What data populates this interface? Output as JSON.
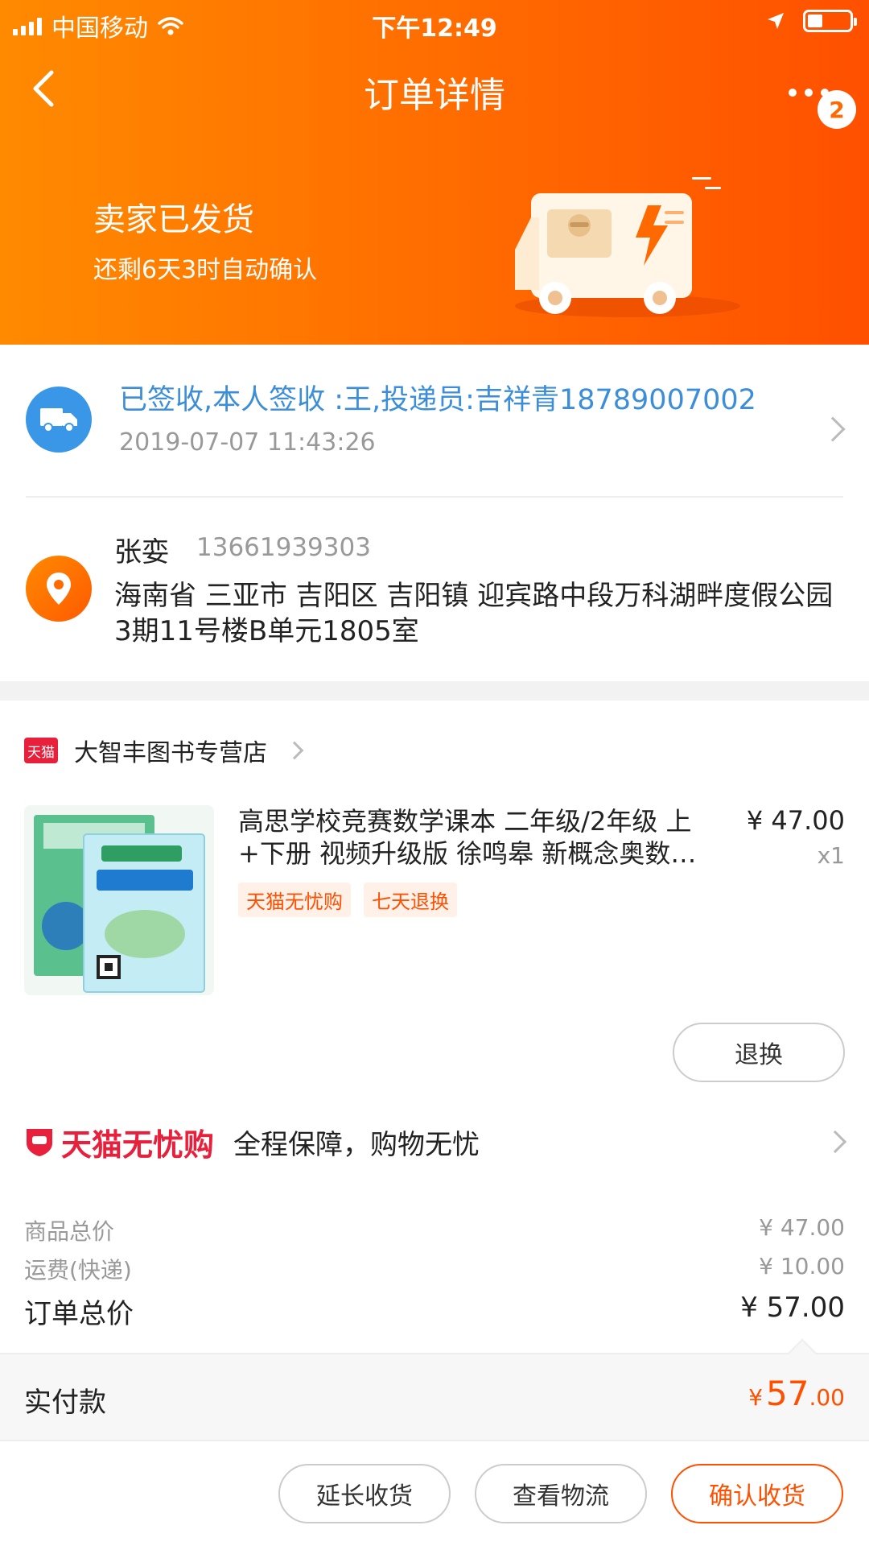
{
  "statusbar": {
    "carrier": "中国移动",
    "time": "下午12:49",
    "battery_level": 0.35
  },
  "nav": {
    "title": "订单详情",
    "badge_count": "2"
  },
  "shipping": {
    "status": "卖家已发货",
    "auto_confirm": "还剩6天3时自动确认"
  },
  "logistics": {
    "latest": "已签收,本人签收 :王,投递员:吉祥青18789007002",
    "time": "2019-07-07 11:43:26"
  },
  "receiver": {
    "name": "张娈",
    "phone": "13661939303",
    "address": "海南省 三亚市 吉阳区 吉阳镇 迎宾路中段万科湖畔度假公园3期11号楼B单元1805室"
  },
  "shop": {
    "badge": "天猫",
    "name": "大智丰图书专营店"
  },
  "product": {
    "title": "高思学校竞赛数学课本 二年级/2年级 上+下册 视频升级版 徐鸣皋 新概念奥数…",
    "price": "¥ 47.00",
    "qty": "x1",
    "tags": [
      "天猫无忧购",
      "七天退换"
    ],
    "exchange_label": "退换"
  },
  "assurance": {
    "logo_text": "天猫无忧购",
    "desc": "全程保障，购物无忧"
  },
  "summary": {
    "goods_label": "商品总价",
    "goods_value": "¥ 47.00",
    "shipping_label": "运费(快递)",
    "shipping_value": "¥ 10.00",
    "total_label": "订单总价",
    "total_value": "¥ 57.00"
  },
  "paid": {
    "label": "实付款",
    "currency": "¥",
    "integer": "57",
    "decimal": ".00"
  },
  "actions": {
    "extend": "延长收货",
    "track": "查看物流",
    "confirm": "确认收货"
  },
  "colors": {
    "header_start": "#ff8a00",
    "header_end": "#ff5000",
    "accent": "#ff5000",
    "link_blue": "#3d8ed8",
    "tmall_red": "#e8203c"
  }
}
